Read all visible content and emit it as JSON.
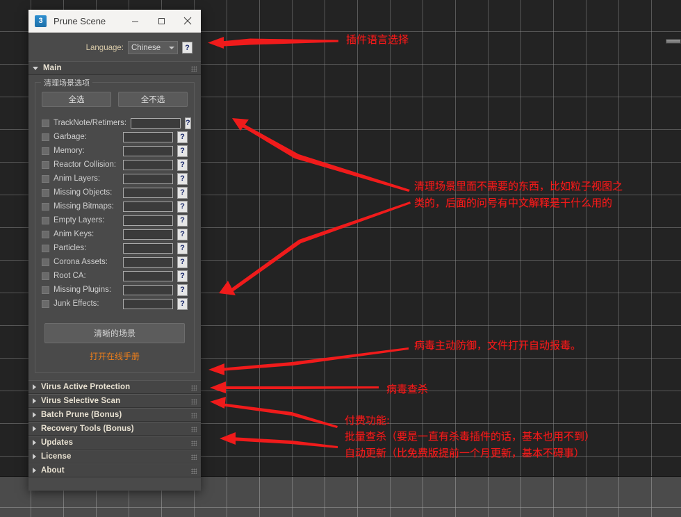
{
  "window": {
    "title": "Prune Scene",
    "icon": "3",
    "minimize": "minimize-icon",
    "maximize": "maximize-icon",
    "close": "close-icon"
  },
  "language": {
    "label": "Language:",
    "value": "Chinese",
    "help": "?"
  },
  "main": {
    "rollout_title": "Main",
    "group_legend": "清理场景选项",
    "select_all": "全选",
    "select_none": "全不选",
    "options": [
      {
        "label": "TrackNote/Retimers:",
        "value": "",
        "help": "?"
      },
      {
        "label": "Garbage:",
        "value": "",
        "help": "?"
      },
      {
        "label": "Memory:",
        "value": "",
        "help": "?"
      },
      {
        "label": "Reactor Collision:",
        "value": "",
        "help": "?"
      },
      {
        "label": "Anim Layers:",
        "value": "",
        "help": "?"
      },
      {
        "label": "Missing Objects:",
        "value": "",
        "help": "?"
      },
      {
        "label": "Missing Bitmaps:",
        "value": "",
        "help": "?"
      },
      {
        "label": "Empty Layers:",
        "value": "",
        "help": "?"
      },
      {
        "label": "Anim Keys:",
        "value": "",
        "help": "?"
      },
      {
        "label": "Particles:",
        "value": "",
        "help": "?"
      },
      {
        "label": "Corona Assets:",
        "value": "",
        "help": "?"
      },
      {
        "label": "Root CA:",
        "value": "",
        "help": "?"
      },
      {
        "label": "Missing Plugins:",
        "value": "",
        "help": "?"
      },
      {
        "label": "Junk Effects:",
        "value": "",
        "help": "?"
      }
    ],
    "clean_button": "清晰的场景",
    "manual_link": "打开在线手册"
  },
  "rollouts": [
    {
      "title": "Virus Active Protection"
    },
    {
      "title": "Virus Selective Scan"
    },
    {
      "title": "Batch Prune (Bonus)"
    },
    {
      "title": "Recovery Tools (Bonus)"
    },
    {
      "title": "Updates"
    },
    {
      "title": "License"
    },
    {
      "title": "About"
    }
  ],
  "annotations": {
    "color": "#f01b1b",
    "language_note": "插件语言选择",
    "main_note_line1": "清理场景里面不需要的东西，比如粒子视图之",
    "main_note_line2": "类的，后面的问号有中文解释是干什么用的",
    "virus_protection_note": "病毒主动防御，文件打开自动报毒。",
    "virus_scan_note": "病毒查杀",
    "paid_title": "付费功能:",
    "paid_line1": "批量查杀（要是一直有杀毒插件的话，基本也用不到）",
    "paid_line2": "自动更新（比免费版提前一个月更新，基本不碍事）"
  }
}
